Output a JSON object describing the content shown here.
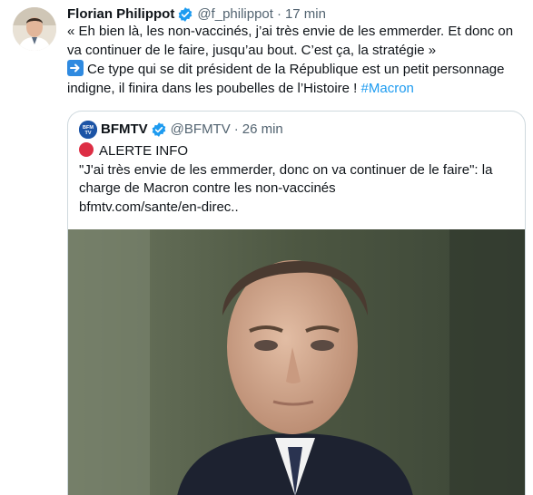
{
  "author": {
    "name": "Florian Philippot",
    "handle": "@f_philippot",
    "time": "17 min"
  },
  "tweet": {
    "line1": "« Eh bien là, les non-vaccinés, j’ai très envie de les emmerder. Et donc on va continuer de le faire, jusqu’au bout. C’est ça, la stratégie »",
    "line2": "Ce type qui se dit président de la République est un petit personnage indigne, il finira dans les poubelles de l’Histoire !",
    "hashtag": "#Macron"
  },
  "quoted": {
    "name": "BFMTV",
    "handle": "@BFMTV",
    "time": "26 min",
    "avatar_text": "BFM TV",
    "alert": "ALERTE INFO",
    "text": "\"J'ai très envie de les emmerder, donc on va continuer de le faire\": la charge de Macron contre les non-vaccinés",
    "link": "bfmtv.com/sante/en-direc.."
  },
  "icons": {
    "verified": "verified-badge-icon",
    "arrow": "right-arrow-emoji-icon",
    "alert": "red-circle-emoji-icon"
  },
  "colors": {
    "verified": "#1d9bf0",
    "hashtag": "#1d9bf0",
    "muted": "#536471",
    "border": "#cfd9de",
    "alert_red": "#dd2e44",
    "bfm_blue": "#1c54a6"
  }
}
